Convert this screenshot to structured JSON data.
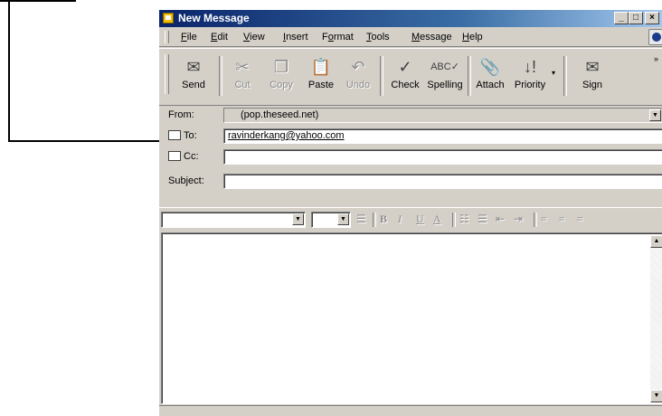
{
  "window": {
    "title": "New Message",
    "controls": [
      "_",
      "□",
      "×"
    ]
  },
  "menu": [
    "File",
    "Edit",
    "View",
    "Insert",
    "Format",
    "Tools",
    "Message",
    "Help"
  ],
  "menu_mnemonic_index": [
    0,
    0,
    0,
    0,
    1,
    0,
    0,
    0
  ],
  "toolbar": [
    {
      "label": "Send",
      "icon": "send-icon",
      "enabled": true
    },
    {
      "label": "Cut",
      "icon": "cut-icon",
      "enabled": false
    },
    {
      "label": "Copy",
      "icon": "copy-icon",
      "enabled": false
    },
    {
      "label": "Paste",
      "icon": "paste-icon",
      "enabled": true
    },
    {
      "label": "Undo",
      "icon": "undo-icon",
      "enabled": false
    },
    {
      "label": "Check",
      "icon": "check-names-icon",
      "enabled": true
    },
    {
      "label": "Spelling",
      "icon": "spelling-icon",
      "enabled": true
    },
    {
      "label": "Attach",
      "icon": "paperclip-icon",
      "enabled": true
    },
    {
      "label": "Priority",
      "icon": "priority-icon",
      "enabled": true
    },
    {
      "label": "Sign",
      "icon": "sign-icon",
      "enabled": true
    }
  ],
  "header": {
    "from_label": "From:",
    "from_value": "(pop.theseed.net)",
    "to_label": "To:",
    "to_value": "ravinderkang@yahoo.com",
    "cc_label": "Cc:",
    "cc_value": "",
    "subject_label": "Subject:",
    "subject_value": ""
  },
  "format_bar": {
    "font_value": "",
    "size_value": "",
    "buttons": [
      "B",
      "I",
      "U",
      "A"
    ]
  },
  "message_body": ""
}
